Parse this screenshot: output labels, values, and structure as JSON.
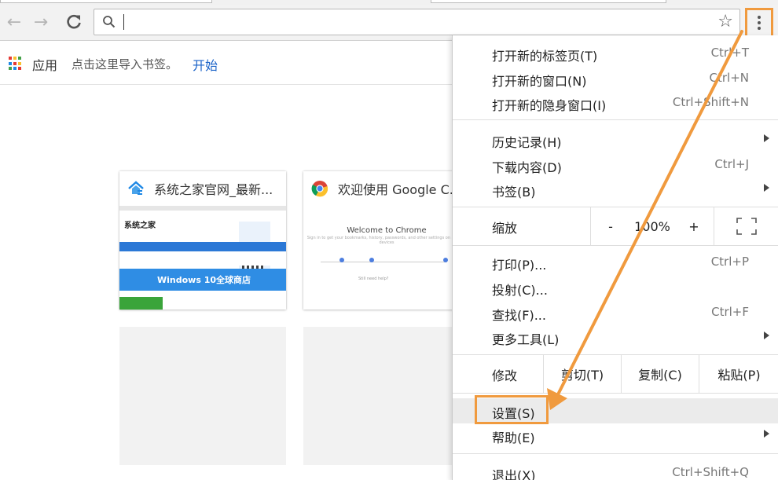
{
  "toolbar": {
    "omnibox_value": "",
    "omnibox_placeholder": ""
  },
  "bookmarks": {
    "apps_label": "应用",
    "import_text": "点击这里导入书签。",
    "start_link": "开始"
  },
  "tiles": [
    {
      "title": "系统之家官网_最新...",
      "thumb": {
        "logo": "系统之家",
        "banner": "Windows 10全球商店"
      }
    },
    {
      "title": "欢迎使用 Google C...",
      "thumb": {
        "heading": "Welcome to Chrome",
        "sub": "Sign in to get your bookmarks, history, passwords, and other settings on all your devices",
        "help": "Still need help?"
      }
    }
  ],
  "menu": {
    "new_tab": {
      "label": "打开新的标签页(T)",
      "shortcut": "Ctrl+T"
    },
    "new_window": {
      "label": "打开新的窗口(N)",
      "shortcut": "Ctrl+N"
    },
    "incognito": {
      "label": "打开新的隐身窗口(I)",
      "shortcut": "Ctrl+Shift+N"
    },
    "history": {
      "label": "历史记录(H)"
    },
    "downloads": {
      "label": "下载内容(D)",
      "shortcut": "Ctrl+J"
    },
    "bookmarks": {
      "label": "书签(B)"
    },
    "zoom": {
      "label": "缩放",
      "minus": "-",
      "value": "100%",
      "plus": "+"
    },
    "print": {
      "label": "打印(P)...",
      "shortcut": "Ctrl+P"
    },
    "cast": {
      "label": "投射(C)..."
    },
    "find": {
      "label": "查找(F)...",
      "shortcut": "Ctrl+F"
    },
    "more_tools": {
      "label": "更多工具(L)"
    },
    "edit": {
      "label": "修改",
      "cut": "剪切(T)",
      "copy": "复制(C)",
      "paste": "粘贴(P)"
    },
    "settings": {
      "label": "设置(S)"
    },
    "help": {
      "label": "帮助(E)"
    },
    "exit": {
      "label": "退出(X)",
      "shortcut": "Ctrl+Shift+Q"
    }
  },
  "colors": {
    "highlight": "#f09a3e",
    "link": "#1b63c8",
    "menu_hover": "#ebebeb"
  },
  "icons": [
    "back-arrow-icon",
    "forward-arrow-icon",
    "reload-icon",
    "search-icon",
    "star-icon",
    "kebab-menu-icon",
    "apps-grid-icon",
    "fullscreen-icon"
  ]
}
